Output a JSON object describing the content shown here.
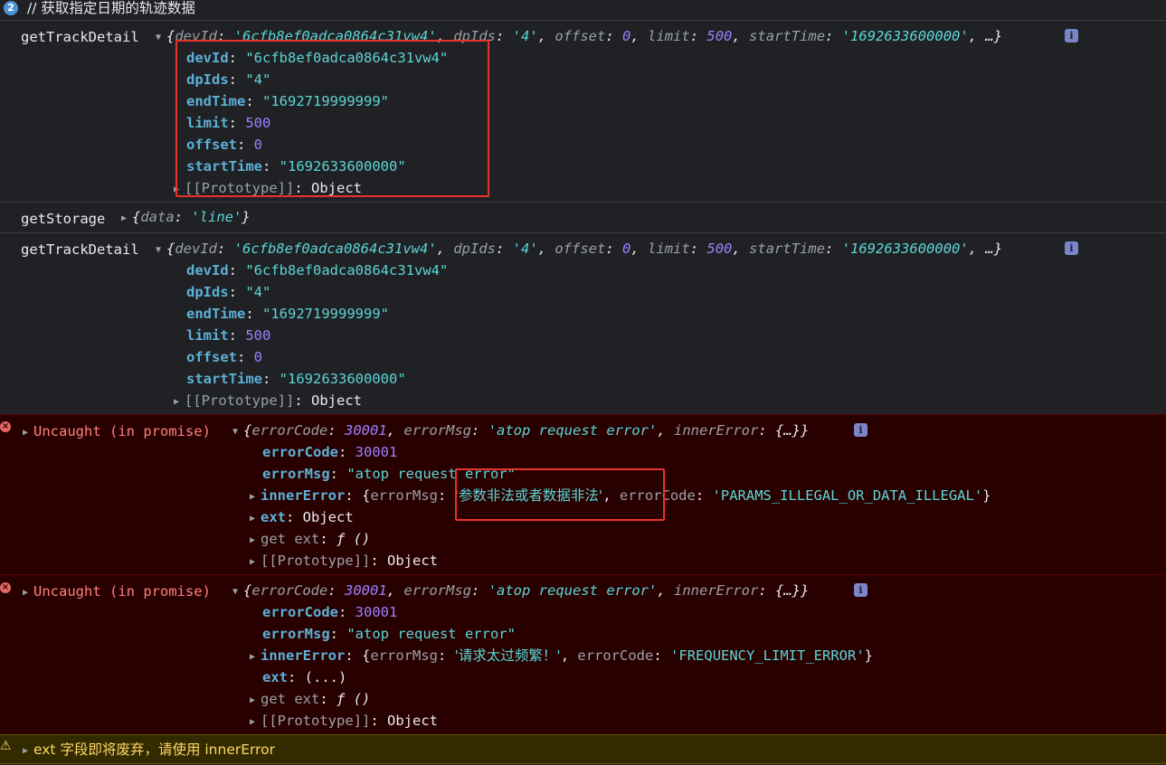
{
  "header": {
    "count": "2",
    "comment": "// 获取指定日期的轨迹数据"
  },
  "log1": {
    "label": "getTrackDetail",
    "summary": {
      "devId_k": "devId",
      "devId_v": "'6cfb8ef0adca0864c31vw4'",
      "dpIds_k": "dpIds",
      "dpIds_v": "'4'",
      "offset_k": "offset",
      "offset_v": "0",
      "limit_k": "limit",
      "limit_v": "500",
      "startTime_k": "startTime",
      "startTime_v": "'1692633600000'",
      "more": ", …}"
    },
    "props": [
      {
        "key": "devId",
        "value": "\"6cfb8ef0adca0864c31vw4\""
      },
      {
        "key": "dpIds",
        "value": "\"4\""
      },
      {
        "key": "endTime",
        "value": "\"1692719999999\""
      },
      {
        "key": "limit",
        "value": "500"
      },
      {
        "key": "offset",
        "value": "0"
      },
      {
        "key": "startTime",
        "value": "\"1692633600000\""
      }
    ],
    "proto_key": "[[Prototype]]",
    "proto_val": "Object"
  },
  "log2": {
    "label": "getStorage",
    "key": "data",
    "value": "'line'"
  },
  "log3": {
    "label": "getTrackDetail",
    "props": [
      {
        "key": "devId",
        "value": "\"6cfb8ef0adca0864c31vw4\""
      },
      {
        "key": "dpIds",
        "value": "\"4\""
      },
      {
        "key": "endTime",
        "value": "\"1692719999999\""
      },
      {
        "key": "limit",
        "value": "500"
      },
      {
        "key": "offset",
        "value": "0"
      },
      {
        "key": "startTime",
        "value": "\"1692633600000\""
      }
    ],
    "proto_key": "[[Prototype]]",
    "proto_val": "Object"
  },
  "error1": {
    "prefix": "Uncaught (in promise)",
    "summary_code": "30001",
    "summary_msg": "'atop request error'",
    "summary_inner": "{…}}",
    "errorCode": "30001",
    "errorMsg": "\"atop request error\"",
    "inner_msg": "'参数非法或者数据非法'",
    "inner_code": "'PARAMS_ILLEGAL_OR_DATA_ILLEGAL'",
    "ext": "Object",
    "get_ext": "get ext",
    "get_ext_val": "ƒ ()",
    "proto": "Object"
  },
  "error2": {
    "prefix": "Uncaught (in promise)",
    "summary_code": "30001",
    "summary_msg": "'atop request error'",
    "summary_inner": "{…}}",
    "errorCode": "30001",
    "errorMsg": "\"atop request error\"",
    "inner_msg": "'请求太过频繁！'",
    "inner_code": "'FREQUENCY_LIMIT_ERROR'",
    "ext": "(...)",
    "get_ext": "get ext",
    "get_ext_val": "ƒ ()",
    "proto": "Object"
  },
  "warning": {
    "text": "ext 字段即将废弃，请使用 innerError"
  },
  "colors": {
    "error_bg": "#290000",
    "warning_bg": "#332b00",
    "highlight_box": "#e8332a"
  }
}
